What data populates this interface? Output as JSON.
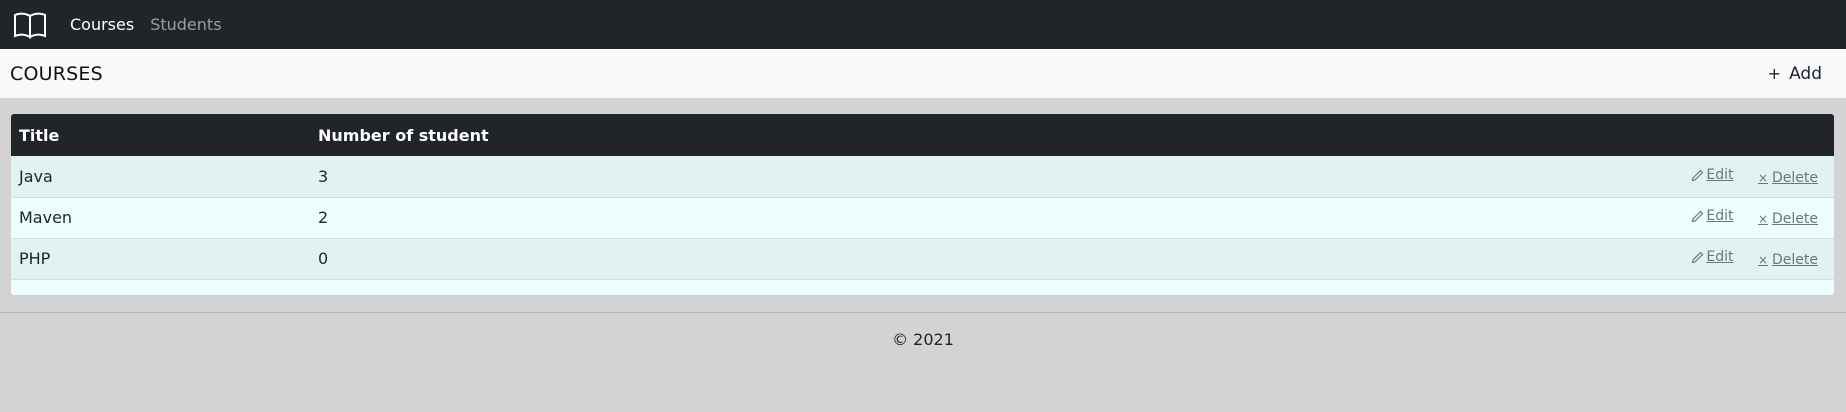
{
  "nav": {
    "brand_icon": "book-icon",
    "links": [
      {
        "label": "Courses",
        "active": true
      },
      {
        "label": "Students",
        "active": false
      }
    ]
  },
  "header": {
    "title": "COURSES",
    "add_label": "Add",
    "add_icon": "plus-icon"
  },
  "table": {
    "columns": [
      "Title",
      "Number of student"
    ],
    "rows": [
      {
        "title": "Java",
        "count": "3"
      },
      {
        "title": "Maven",
        "count": "2"
      },
      {
        "title": "PHP",
        "count": "0"
      }
    ],
    "edit_label": "Edit",
    "delete_label": "Delete",
    "edit_icon": "pencil-icon",
    "delete_icon": "x-icon"
  },
  "footer": {
    "text": "© 2021"
  }
}
